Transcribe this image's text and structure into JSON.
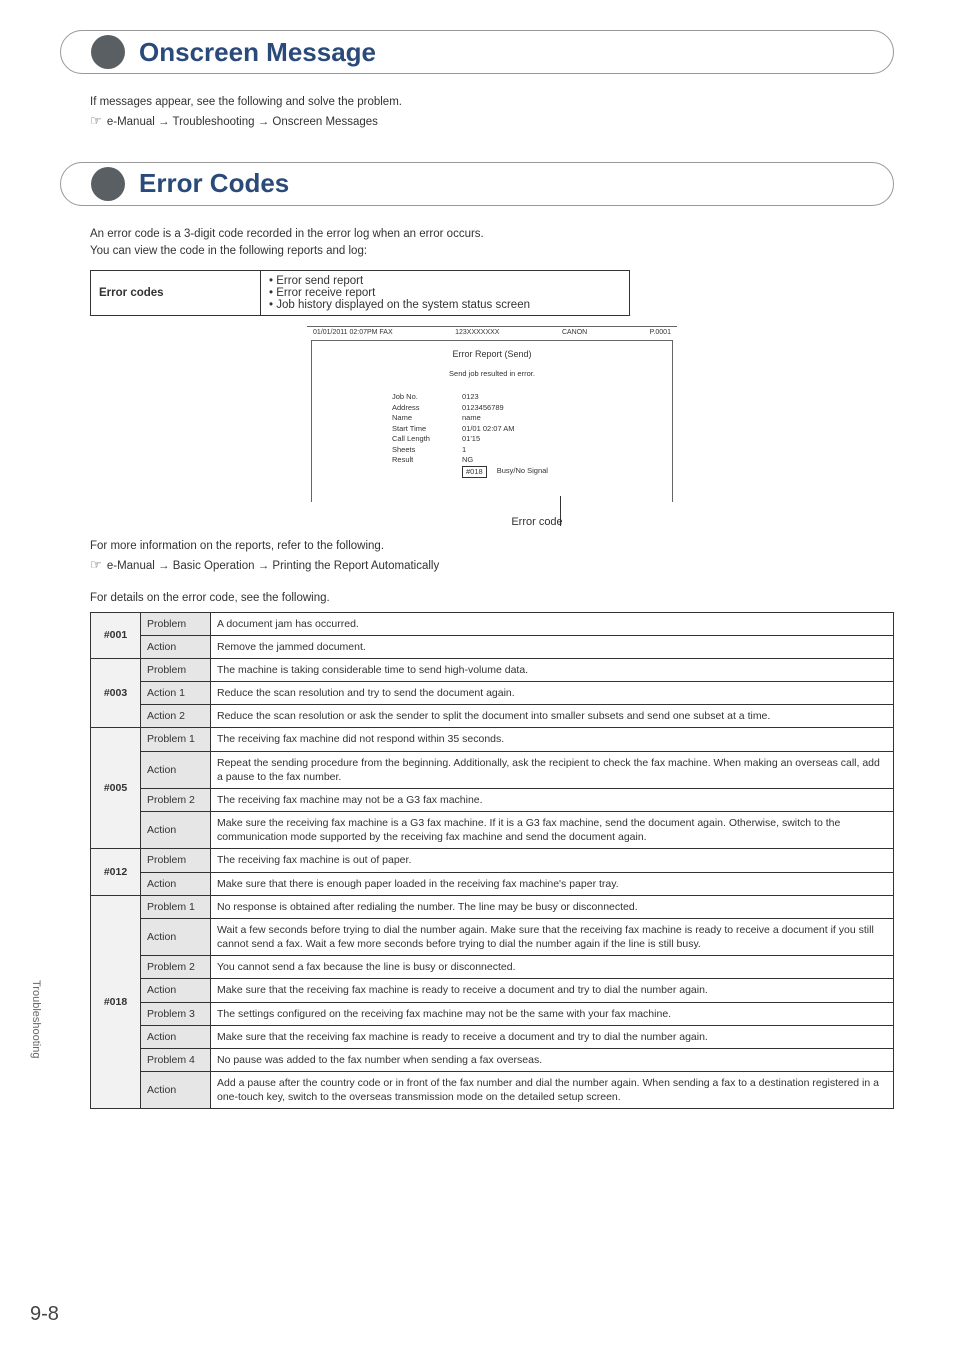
{
  "sideTab": "Troubleshooting",
  "pageNumber": "9-8",
  "onscreen": {
    "title": "Onscreen Message",
    "intro1": "If messages appear, see the following and solve the problem.",
    "intro2": "e-Manual → Troubleshooting → Onscreen Messages"
  },
  "errorCodes": {
    "title": "Error Codes",
    "desc1": "An error code is a 3-digit code recorded in the error log when an error occurs.",
    "desc2": "You can view the code in the following reports and log:",
    "miniTable": {
      "left": "Error codes",
      "b1": "Error send report",
      "b2": "Error receive report",
      "b3": "Job history displayed on the system status screen"
    },
    "report": {
      "hdr_date": "01/01/2011 02:07PM FAX",
      "hdr_num": "123XXXXXXX",
      "hdr_name": "CANON",
      "hdr_page": "P.0001",
      "title": "Error Report (Send)",
      "subtitle": "Send job resulted in error.",
      "rows": [
        {
          "k": "Job No.",
          "v": "0123"
        },
        {
          "k": "Address",
          "v": "0123456789"
        },
        {
          "k": "Name",
          "v": "name"
        },
        {
          "k": "Start Time",
          "v": "01/01 02:07 AM"
        },
        {
          "k": "Call Length",
          "v": "01'15"
        },
        {
          "k": "Sheets",
          "v": "1"
        },
        {
          "k": "Result",
          "v": "NG"
        }
      ],
      "resultCode": "#018",
      "resultMsg": "Busy/No Signal"
    },
    "callout": "Error code",
    "moreInfo1": "For more information on the reports, refer to the following.",
    "moreInfo2": "e-Manual → Basic Operation → Printing the Report Automatically",
    "detailsIntro": "For details on the error code, see the following.",
    "table": [
      {
        "code": "#001",
        "rows": [
          {
            "label": "Problem",
            "text": "A document jam has occurred."
          },
          {
            "label": "Action",
            "text": "Remove the jammed document."
          }
        ]
      },
      {
        "code": "#003",
        "rows": [
          {
            "label": "Problem",
            "text": "The machine is taking considerable time to send high-volume data."
          },
          {
            "label": "Action 1",
            "text": "Reduce the scan resolution and try to send the document again."
          },
          {
            "label": "Action 2",
            "text": "Reduce the scan resolution or ask the sender to split the document into smaller subsets and send one subset at a time."
          }
        ]
      },
      {
        "code": "#005",
        "rows": [
          {
            "label": "Problem 1",
            "text": "The receiving fax machine did not respond within 35 seconds."
          },
          {
            "label": "Action",
            "text": "Repeat the sending procedure from the beginning. Additionally, ask the recipient to check the fax machine. When making an overseas call, add a pause to the fax number."
          },
          {
            "label": "Problem 2",
            "text": "The receiving fax machine may not be a G3 fax machine."
          },
          {
            "label": "Action",
            "text": "Make sure the receiving fax machine is a G3 fax machine. If it is a G3 fax machine, send the document again. Otherwise, switch to the communication mode supported by the receiving fax machine and send the document again."
          }
        ]
      },
      {
        "code": "#012",
        "rows": [
          {
            "label": "Problem",
            "text": "The receiving fax machine is out of paper."
          },
          {
            "label": "Action",
            "text": "Make sure that there is enough paper loaded in the receiving fax machine's paper tray."
          }
        ]
      },
      {
        "code": "#018",
        "rows": [
          {
            "label": "Problem 1",
            "text": "No response is obtained after redialing the number. The line may be busy or disconnected."
          },
          {
            "label": "Action",
            "text": "Wait a few seconds before trying to dial the number again. Make sure that the receiving fax machine is ready to receive a document if you still cannot send a fax. Wait a few more seconds before trying to dial the number again if the line is still busy."
          },
          {
            "label": "Problem 2",
            "text": "You cannot send a fax because the line is busy or disconnected."
          },
          {
            "label": "Action",
            "text": "Make sure that the receiving fax machine is ready to receive a document and try to dial the number again."
          },
          {
            "label": "Problem 3",
            "text": "The settings configured on the receiving fax machine may not be the same with your fax machine."
          },
          {
            "label": "Action",
            "text": "Make sure that the receiving fax machine is ready to receive a document and try to dial the number again."
          },
          {
            "label": "Problem 4",
            "text": "No pause was added to the fax number when sending a fax overseas."
          },
          {
            "label": "Action",
            "text": "Add a pause after the country code or in front of the fax number and dial the number again. When sending a fax to a destination registered in a one-touch key, switch to the overseas transmission mode on the detailed setup screen."
          }
        ]
      }
    ]
  }
}
